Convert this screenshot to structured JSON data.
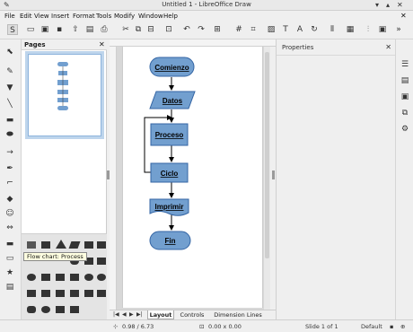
{
  "window": {
    "title": "Untitled 1 - LibreOffice Draw"
  },
  "menu": [
    "File",
    "Edit",
    "View",
    "Insert",
    "Format",
    "Tools",
    "Modify",
    "Window",
    "Help"
  ],
  "pages_panel": {
    "title": "Pages",
    "page_number": "1"
  },
  "tooltip": "Flow chart: Process",
  "flowchart": {
    "nodes": [
      "Comienzo",
      "Datos",
      "Proceso",
      "Ciclo",
      "Imprimir",
      "Fin"
    ]
  },
  "tabs": [
    "Layout",
    "Controls",
    "Dimension Lines"
  ],
  "properties": {
    "title": "Properties"
  },
  "status": {
    "position": "0.98 / 6.73",
    "size": "0.00 x 0.00",
    "slide": "Slide 1 of 1",
    "style": "Default"
  },
  "colors": {
    "shape_fill": "#729fcf",
    "shape_border": "#3465a4"
  }
}
